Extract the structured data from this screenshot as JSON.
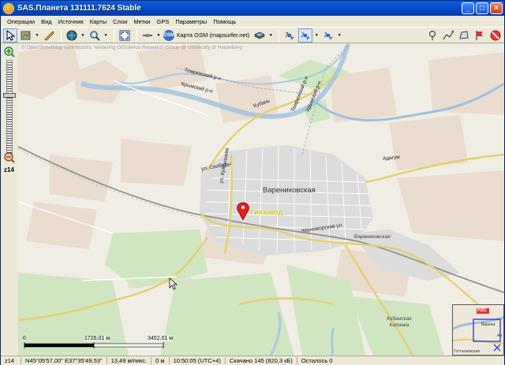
{
  "window": {
    "title": "SAS.Планета 131111.7624 Stable"
  },
  "menu": [
    "Операции",
    "Вид",
    "Источник",
    "Карты",
    "Слои",
    "Метки",
    "GPS",
    "Параметры",
    "Помощь"
  ],
  "toolbar": {
    "osm_badge": "OSM",
    "map_source": "Карта OSM (mapsurfer.net)"
  },
  "zoom": {
    "level_label": "z14"
  },
  "map": {
    "attribution": "© OpenStreetMap contributors, rendering GIScience Research Group @ University of Heidelberg",
    "places": {
      "town": "Варениковская",
      "village": "Варениковская",
      "kolonka": "Кубанская Колонка",
      "poi": "Гиазавод"
    },
    "streets": {
      "svobody": "ул. Свободы",
      "kuybysheva": "ул. Куйбышева",
      "chernomorskaya": "Черноморская ул.",
      "adagum": "Адагум",
      "tomrjuksky": "Темрюкский р-н",
      "krymsky": "Крымский р-н",
      "kuban": "Кубань",
      "temr2": "Темрюкский р-н",
      "krym2": "Крымский р-н"
    },
    "scale": {
      "zero": "0",
      "mid": "1726,01 м",
      "end": "3452,01 м"
    },
    "minimap": {
      "road_badge": "P251",
      "label1": "Варени",
      "label2": "Гостагаевская",
      "label3": "Ан"
    }
  },
  "status": {
    "zoom": "z14",
    "coords": "N45°05'57,00\" E37°35'49,53\"",
    "resolution": "13,49 м/пикс.",
    "altitude": "0 м",
    "time": "10:50:05 (UTC+4)",
    "downloaded": "Скачано 145 (820,3 кБ)",
    "remaining": "Осталось 0"
  }
}
